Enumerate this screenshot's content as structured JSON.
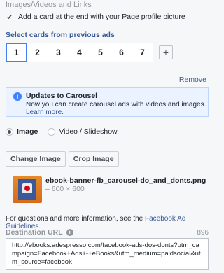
{
  "section": {
    "title": "Images/Videos and Links"
  },
  "profile_card": {
    "checked": true,
    "label": "Add a card at the end with your Page profile picture"
  },
  "cards": {
    "select_title": "Select cards from previous ads",
    "tabs": [
      "1",
      "2",
      "3",
      "4",
      "5",
      "6",
      "7"
    ],
    "active_tab": "1",
    "add_label": "+"
  },
  "remove_label": "Remove",
  "info": {
    "icon": "info-icon",
    "icon_glyph": "i",
    "title": "Updates to Carousel",
    "body": "Now you can create carousel ads with videos and images.",
    "link": "Learn more."
  },
  "media_type": {
    "options": [
      "Image",
      "Video / Slideshow"
    ],
    "selected": "Image"
  },
  "buttons": {
    "change_image": "Change Image",
    "crop_image": "Crop Image"
  },
  "file": {
    "name": "ebook-banner-fb_carousel-do_and_donts.png",
    "size": " – 600 × 600"
  },
  "help": {
    "text": "For questions and more information, see the ",
    "link": "Facebook Ad Guidelines."
  },
  "destination": {
    "label": "Destination URL",
    "info_glyph": "i",
    "remaining": "896",
    "value": "http://ebooks.adespresso.com/facebook-ads-dos-donts?utm_campaign=Facebook+Ads+-+eBooks&utm_medium=paidsocial&utm_source=facebook"
  },
  "colors": {
    "accent": "#4080ff",
    "link": "#365899",
    "info_bg": "#eaf3ff"
  }
}
